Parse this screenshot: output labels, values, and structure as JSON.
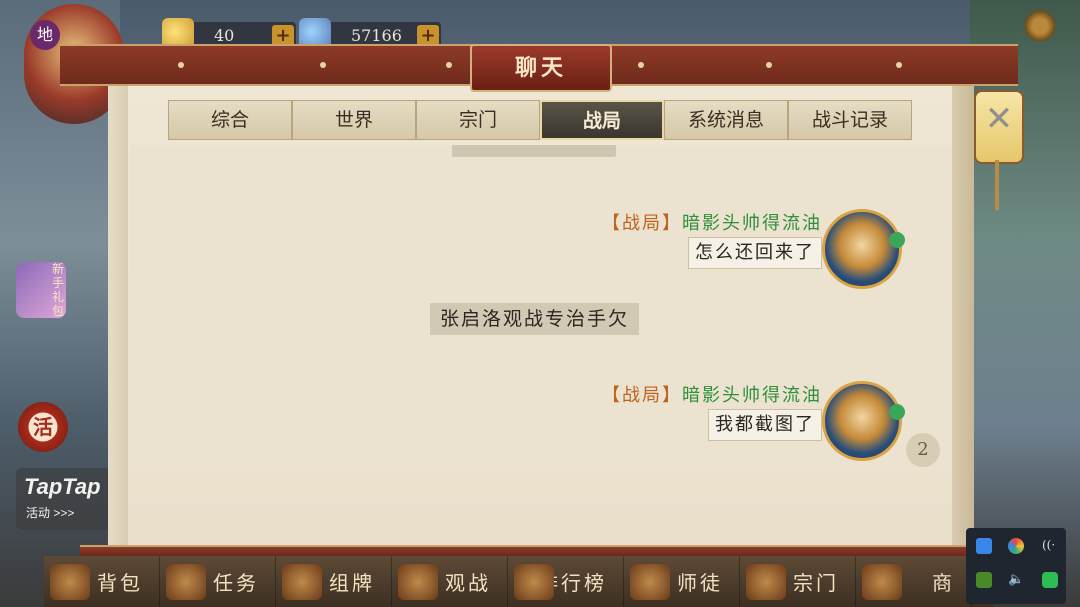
{
  "window": {
    "title": "聊天"
  },
  "resources": {
    "gold": {
      "value": "40"
    },
    "gems": {
      "value": "57166"
    }
  },
  "avatar_tag": "地",
  "side": {
    "gift_label": "新手礼包",
    "activity_label": "活",
    "taptap": {
      "logo": "TapTap",
      "sub": "活动 >>>"
    }
  },
  "tabs": [
    {
      "label": "综合",
      "active": false
    },
    {
      "label": "世界",
      "active": false
    },
    {
      "label": "宗门",
      "active": false
    },
    {
      "label": "战局",
      "active": true
    },
    {
      "label": "系统消息",
      "active": false
    },
    {
      "label": "战斗记录",
      "active": false
    }
  ],
  "messages": [
    {
      "channel": "【战局】",
      "sender": "暗影头帅得流油",
      "text": "怎么还回来了"
    },
    {
      "system": "张启洛观战专治手欠"
    },
    {
      "channel": "【战局】",
      "sender": "暗影头帅得流油",
      "text": "我都截图了"
    }
  ],
  "unread_count": "2",
  "bottom_nav": [
    {
      "label": "背包"
    },
    {
      "label": "任务"
    },
    {
      "label": "组牌"
    },
    {
      "label": "观战"
    },
    {
      "label": "排行榜"
    },
    {
      "label": "师徒"
    },
    {
      "label": "宗门"
    },
    {
      "label": "商"
    }
  ],
  "icons": {
    "close": "close-icon",
    "settings": "gear-icon"
  }
}
